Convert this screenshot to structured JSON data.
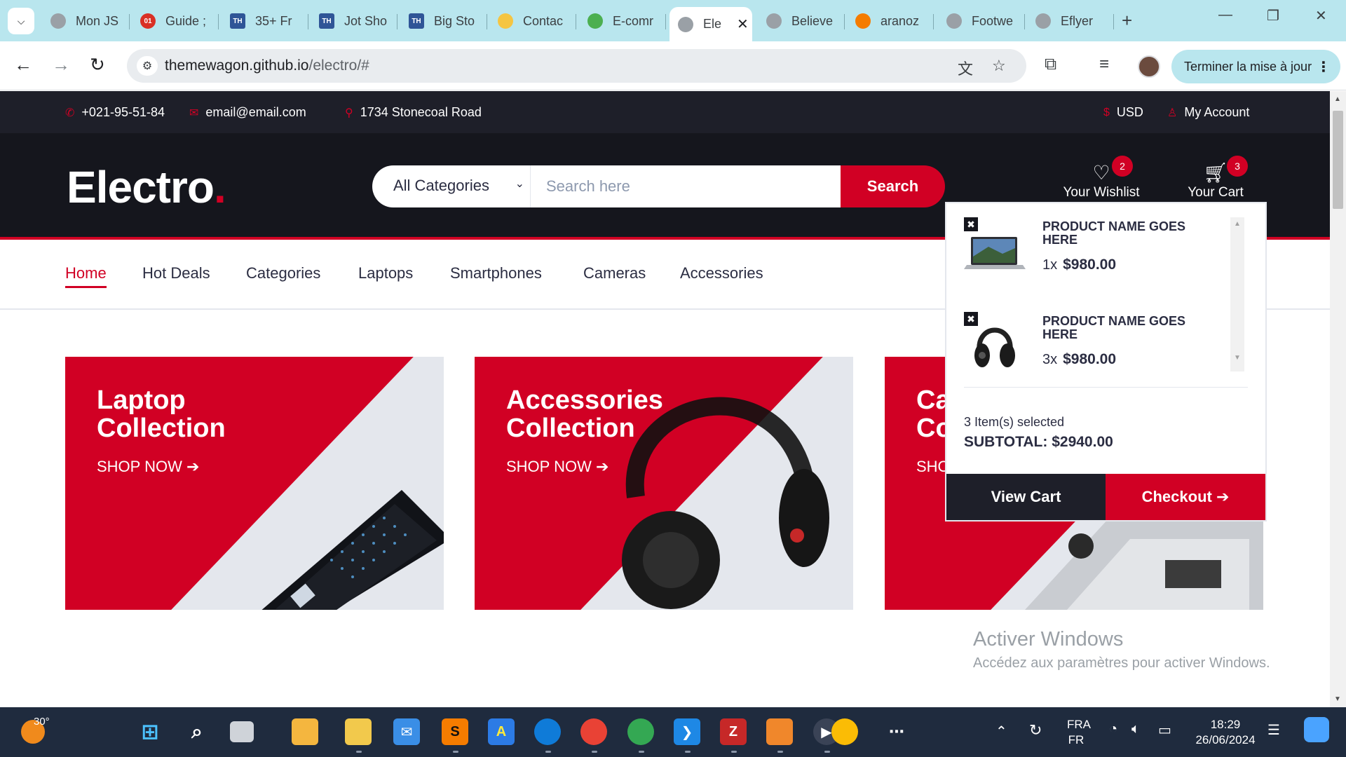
{
  "browser": {
    "tabs": [
      {
        "label": "Mon JS",
        "icon": "globe-icon"
      },
      {
        "label": "Guide ;",
        "icon": "o1-icon"
      },
      {
        "label": "35+ Fr",
        "icon": "th-icon"
      },
      {
        "label": "Jot Sho",
        "icon": "th-icon"
      },
      {
        "label": "Big Sto",
        "icon": "th-icon"
      },
      {
        "label": "Contac",
        "icon": "hand-icon"
      },
      {
        "label": "E-comr",
        "icon": "leaf-icon"
      },
      {
        "label": "Ele",
        "icon": "globe-icon"
      },
      {
        "label": "Believe",
        "icon": "globe-icon"
      },
      {
        "label": "aranoz",
        "icon": "swirl-icon"
      },
      {
        "label": "Footwe",
        "icon": "globe-icon"
      },
      {
        "label": "Eflyer",
        "icon": "globe-icon"
      }
    ],
    "url_host": "themewagon.github.io",
    "url_path": "/electro/#",
    "update_button": "Terminer la mise à jour"
  },
  "topbar": {
    "phone": "+021-95-51-84",
    "email": "email@email.com",
    "address": "1734 Stonecoal Road",
    "currency": "USD",
    "account": "My Account"
  },
  "header": {
    "logo_text": "Electro",
    "logo_dot": ".",
    "category_select": "All Categories",
    "search_placeholder": "Search here",
    "search_button": "Search",
    "wishlist_label": "Your Wishlist",
    "wishlist_count": "2",
    "cart_label": "Your Cart",
    "cart_count": "3"
  },
  "nav": {
    "items": [
      "Home",
      "Hot Deals",
      "Categories",
      "Laptops",
      "Smartphones",
      "Cameras",
      "Accessories"
    ],
    "active": "Home"
  },
  "shop_banners": [
    {
      "title_line1": "Laptop",
      "title_line2": "Collection",
      "cta": "SHOP NOW"
    },
    {
      "title_line1": "Accessories",
      "title_line2": "Collection",
      "cta": "SHOP NOW"
    },
    {
      "title_line1": "Ca",
      "title_line2": "Co",
      "cta": "SHO"
    }
  ],
  "cart": {
    "items": [
      {
        "name": "PRODUCT NAME GOES HERE",
        "qty": "1x",
        "price": "$980.00",
        "product_icon": "laptop-icon"
      },
      {
        "name": "PRODUCT NAME GOES HERE",
        "qty": "3x",
        "price": "$980.00",
        "product_icon": "headphones-icon"
      }
    ],
    "count_text": "3 Item(s) selected",
    "subtotal": "SUBTOTAL: $2940.00",
    "view_cart": "View Cart",
    "checkout": "Checkout"
  },
  "watermark": {
    "title": "Activer Windows",
    "subtitle": "Accédez aux paramètres pour activer Windows."
  },
  "taskbar": {
    "temperature": "30°",
    "lang_top": "FRA",
    "lang_bottom": "FR",
    "time": "18:29",
    "date": "26/06/2024"
  },
  "colors": {
    "accent": "#d10024",
    "header_dark": "#15161d",
    "topbar_dark": "#1e1f29",
    "chrome_tab": "#b9e6ee"
  }
}
